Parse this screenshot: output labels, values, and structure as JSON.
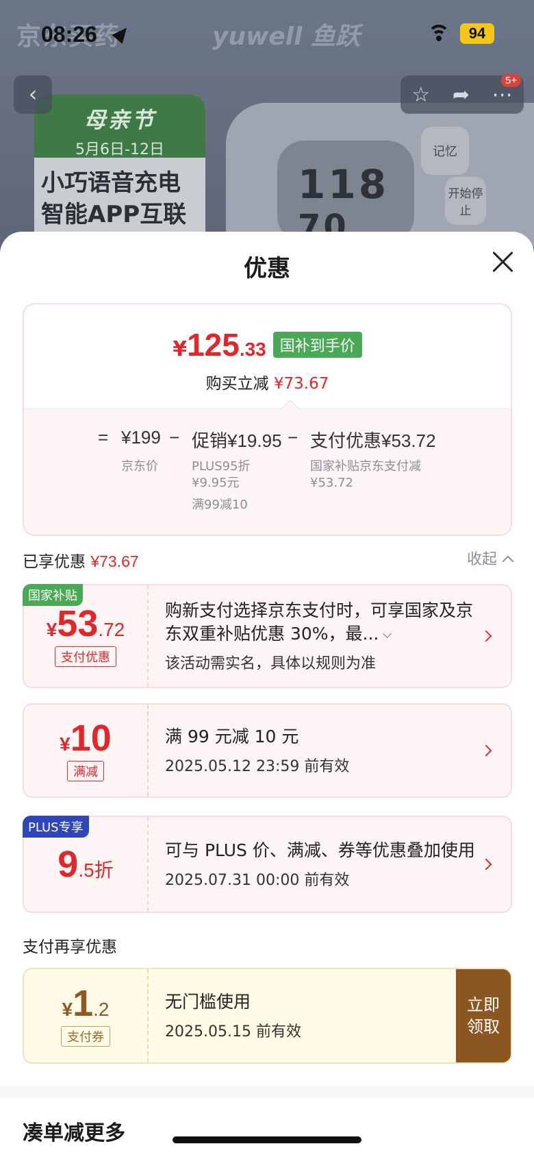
{
  "status_bar": {
    "time": "08:26",
    "battery": "94"
  },
  "background": {
    "brand": "京东买药",
    "brand2": "yuwell 鱼跃",
    "promo_title": "母亲节",
    "promo_date": "5月6日-12日",
    "promo_line1": "小巧语音充电",
    "promo_line2": "智能APP互联",
    "screen_reading1": "118",
    "screen_reading2": "70",
    "device_btn_memory": "记忆",
    "device_btn_start": "开始停止",
    "nav_badge": "5+"
  },
  "sheet": {
    "title": "优惠",
    "summary": {
      "yen": "¥",
      "price_int": "125",
      "price_dec": ".33",
      "tag": "国补到手价",
      "reduce_label": "购买立减",
      "reduce_value": "¥73.67",
      "calc": {
        "eq": "=",
        "base": "¥199",
        "minus1": "−",
        "promo": "促销¥19.95",
        "minus2": "−",
        "pay": "支付优惠¥53.72",
        "base_label": "京东价",
        "promo_line1": "PLUS95折",
        "promo_line2": "¥9.95元",
        "promo_line3": "满99减10",
        "pay_line1": "国家补贴京东支付减",
        "pay_line2": "¥53.72"
      }
    },
    "enjoyed": {
      "label": "已享优惠",
      "value": "¥73.67",
      "collapse": "收起"
    },
    "coupons": [
      {
        "corner": "国家补贴",
        "yen": "¥",
        "int": "53",
        "dec": ".72",
        "tag": "支付优惠",
        "title": "购新支付选择京东支付时，可享国家及京东双重补贴优惠 30%，最...",
        "sub": "该活动需实名，具体以规则为准"
      },
      {
        "yen": "¥",
        "int": "10",
        "tag": "满减",
        "title": "满 99 元减 10 元",
        "sub": "2025.05.12 23:59 前有效"
      },
      {
        "corner": "PLUS专享",
        "int": "9",
        "dec": ".5折",
        "title": "可与 PLUS 价、满减、券等优惠叠加使用",
        "sub": "2025.07.31 00:00 前有效"
      }
    ],
    "pay_section": {
      "label": "支付再享优惠",
      "coupon": {
        "yen": "¥",
        "int": "1",
        "dec": ".2",
        "tag": "支付券",
        "title": "无门槛使用",
        "sub": "2025.05.15 前有效",
        "button": "立即领取"
      }
    },
    "more_title": "凑单减更多"
  },
  "colors": {
    "accent_red": "#e0282b",
    "gov_green": "#4aa857",
    "plus_blue": "#2f46b8",
    "gold_brown": "#8c5620"
  }
}
